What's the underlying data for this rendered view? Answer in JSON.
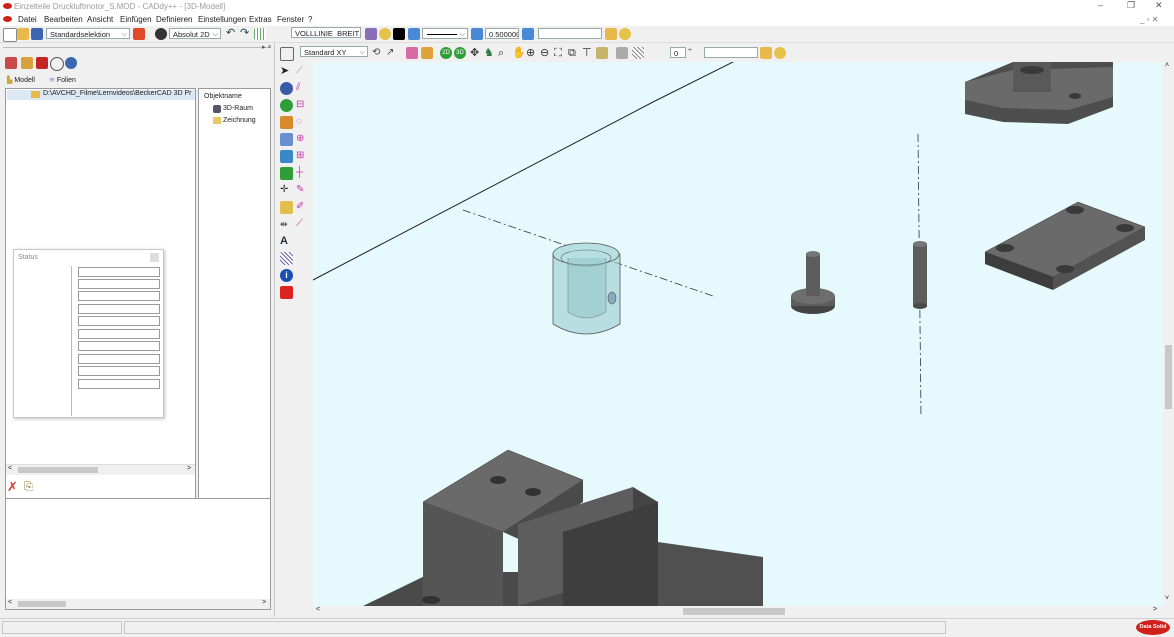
{
  "window": {
    "title": "Einzelteile Druckluftmotor_S.MOD  -  CADdy++ - [3D-Modell]",
    "controls": [
      "–",
      "❐",
      "✕"
    ],
    "mdi_controls": "_ ▫ ✕"
  },
  "menu": {
    "items": [
      "Datei",
      "Bearbeiten",
      "Ansicht",
      "Einfügen",
      "Definieren",
      "Einstellungen",
      "Extras",
      "Fenster",
      "?"
    ]
  },
  "toolbar": {
    "selection_mode": "Standardselektion",
    "coord_mode": "Absolut 2D",
    "line_type": "VOLLLINIE_BREIT",
    "line_width": "0.500000",
    "color_field": ""
  },
  "toolbar2": {
    "view": "Standard XY",
    "btn_2d": "2D",
    "btn_3d": "3D",
    "layer_value": "0",
    "text_field": ""
  },
  "left_panel": {
    "tabs": [
      "Modell",
      "Folien"
    ],
    "tree_path": "D:\\AVCHD_Filme\\Lernvideos\\BeckerCAD 3D Pr",
    "object_header": "Objektname",
    "objects": [
      "3D-Raum",
      "Zeichnung"
    ],
    "status_title": "Status"
  },
  "colors": {
    "viewport_bg": "#e6fafd",
    "part_grey": "#5d5d5d",
    "glass_part": "#9fcfd3",
    "logo_red": "#d0201b"
  },
  "statusbar": {
    "cells": [
      "",
      "",
      ""
    ],
    "logo": "Data Solid"
  }
}
